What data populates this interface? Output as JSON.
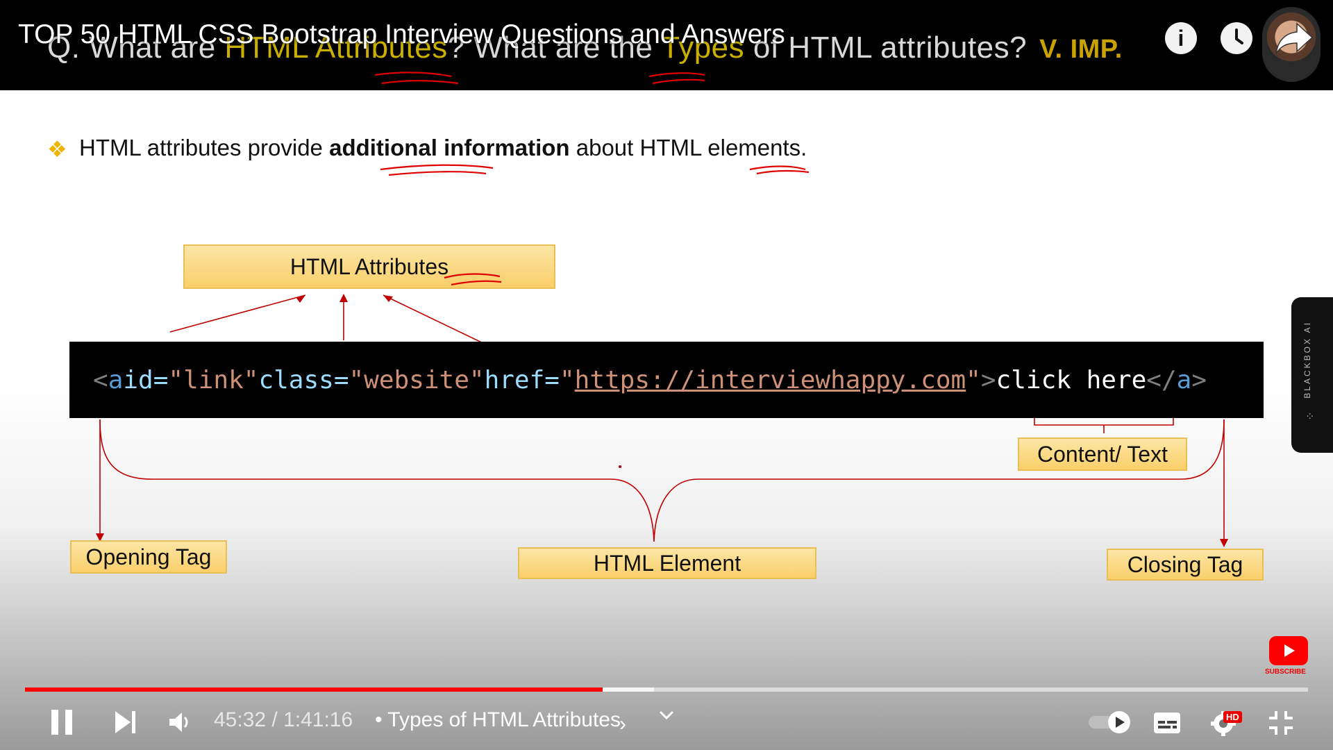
{
  "video": {
    "title": "TOP 50 HTML CSS Bootstrap Interview Questions and Answers"
  },
  "slide": {
    "question_prefix": "Q. What are ",
    "question_hl1": "HTML Attributes",
    "question_mid": "? What are the ",
    "question_hl2": "Types",
    "question_suffix": " of HTML attributes?",
    "importance": "V. IMP.",
    "bullet_prefix": "HTML attributes provide ",
    "bullet_bold": "additional information",
    "bullet_suffix": " about HTML elements.",
    "labels": {
      "html_attributes": "HTML Attributes",
      "content_text": "Content/ Text",
      "opening_tag": "Opening Tag",
      "html_element": "HTML Element",
      "closing_tag": "Closing Tag"
    },
    "code": {
      "lt": "<",
      "tag": "a",
      "attr1": "id=",
      "val1": "\"link\"",
      "attr2": "class=",
      "val2": "\"website\"",
      "attr3": "href=",
      "q_open": "\"",
      "url": "https://interviewhappy.com",
      "q_close": "\"",
      "gt": ">",
      "content": "click here",
      "close_lt": "</",
      "close_tag": "a",
      "close_gt": ">"
    }
  },
  "overlay": {
    "blackbox_label": "BLACKBOX AI",
    "subscribe_label": "SUBSCRIBE"
  },
  "player": {
    "current_time": "45:32",
    "duration": "1:41:16",
    "time_display": "45:32 / 1:41:16",
    "chapter": "• Types of HTML Attributes",
    "progress_played": 0.45,
    "progress_buffered": 0.49,
    "quality_badge": "HD",
    "accent_color": "#ff0000",
    "icons": [
      "info-icon",
      "watch-later-icon",
      "share-icon",
      "pause-icon",
      "next-icon",
      "volume-icon",
      "chevron-right-icon",
      "chevron-down-icon",
      "autoplay-toggle-icon",
      "captions-icon",
      "settings-icon",
      "exit-fullscreen-icon"
    ]
  }
}
